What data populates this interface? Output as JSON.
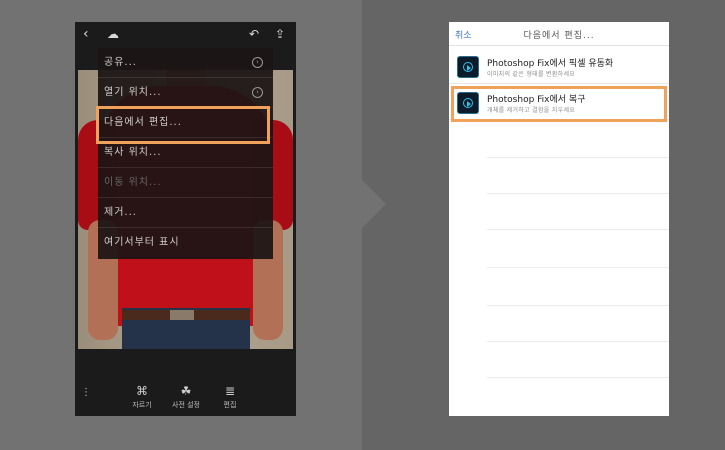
{
  "left_phone": {
    "topbar": {
      "back_icon": "chevron-left-icon",
      "cloud_icon": "cloud-settings-icon",
      "undo_icon": "undo-icon",
      "share_icon": "share-icon"
    },
    "menu": {
      "items": [
        {
          "label": "공유...",
          "has_arrow": true,
          "enabled": true
        },
        {
          "label": "열기 위치...",
          "has_arrow": true,
          "enabled": true
        },
        {
          "label": "다음에서 편집...",
          "has_arrow": false,
          "enabled": true,
          "highlighted": true
        },
        {
          "label": "복사 위치...",
          "has_arrow": false,
          "enabled": true
        },
        {
          "label": "이동 위치...",
          "has_arrow": false,
          "enabled": false
        },
        {
          "label": "제거...",
          "has_arrow": false,
          "enabled": true
        },
        {
          "label": "여기서부터 표시",
          "has_arrow": false,
          "enabled": true
        }
      ]
    },
    "bottombar": {
      "tools": [
        {
          "label": "자르기",
          "icon": "crop-icon"
        },
        {
          "label": "사전 설정",
          "icon": "presets-icon"
        },
        {
          "label": "편집",
          "icon": "sliders-icon"
        }
      ]
    }
  },
  "right_phone": {
    "header": {
      "cancel": "취소",
      "title": "다음에서 편집..."
    },
    "apps": [
      {
        "title": "Photoshop Fix에서 픽셀 유동화",
        "subtitle": "이미지의 같은 형태를 변환하세요",
        "icon": "photoshop-fix-icon"
      },
      {
        "title": "Photoshop Fix에서 복구",
        "subtitle": "개체를 제거하고 결함을 지우세요",
        "icon": "photoshop-fix-icon",
        "highlighted": true
      }
    ]
  },
  "colors": {
    "highlight": "#f0a25a",
    "link": "#3a74c8"
  }
}
